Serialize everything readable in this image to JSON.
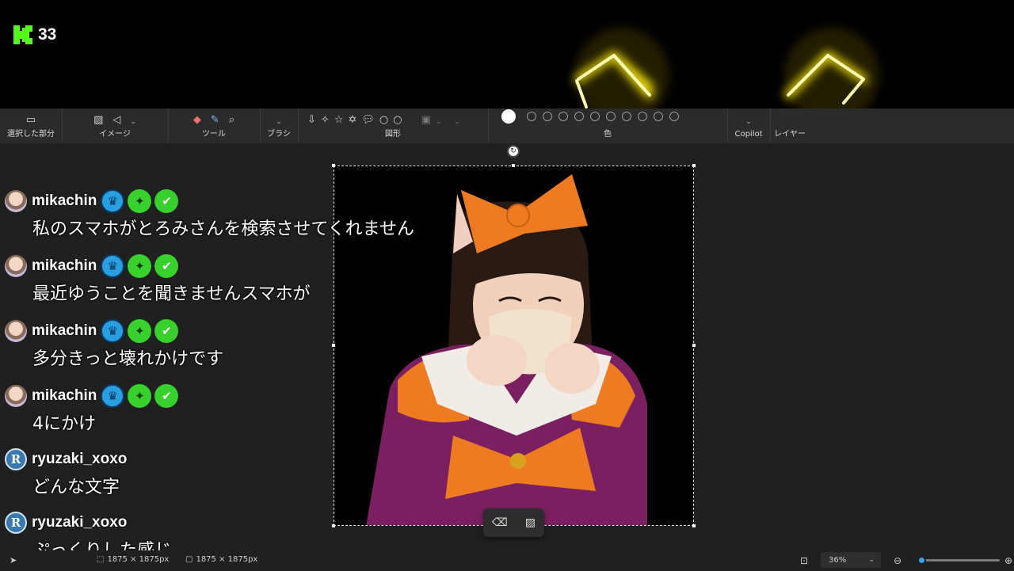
{
  "stream": {
    "viewer_count": "33",
    "brand_icon": "kick-logo-icon",
    "accent": "#53fc18"
  },
  "ribbon": {
    "groups": [
      {
        "label": "選択した部分"
      },
      {
        "label": "イメージ"
      },
      {
        "label": "ツール"
      },
      {
        "label": "ブラシ"
      },
      {
        "label": "図形"
      },
      {
        "label": "色"
      },
      {
        "label": "Copilot"
      },
      {
        "label": "レイヤー"
      }
    ],
    "selected_color": "#ffffff"
  },
  "chat": {
    "messages": [
      {
        "user": "mikachin",
        "text": "私のスマホがとろみさんを検索させてくれません",
        "avatar": "m",
        "badges": [
          "crown",
          "star",
          "check"
        ]
      },
      {
        "user": "mikachin",
        "text": "最近ゆうことを聞きませんスマホが",
        "avatar": "m",
        "badges": [
          "crown",
          "star",
          "check"
        ]
      },
      {
        "user": "mikachin",
        "text": "多分きっと壊れかけです",
        "avatar": "m",
        "badges": [
          "crown",
          "star",
          "check"
        ]
      },
      {
        "user": "mikachin",
        "text": "4にかけ",
        "avatar": "m",
        "badges": [
          "crown",
          "star",
          "check"
        ]
      },
      {
        "user": "ryuzaki_xoxo",
        "text": "どんな文字",
        "avatar": "r",
        "badges": []
      },
      {
        "user": "ryuzaki_xoxo",
        "text": "ぷっくりした感じ",
        "avatar": "r",
        "badges": []
      }
    ],
    "avatar_letter_r": "R"
  },
  "status": {
    "selection_size": "1875 × 1875px",
    "canvas_size": "1875 × 1875px",
    "zoom": "36%",
    "zoom_fraction": 0.05
  }
}
